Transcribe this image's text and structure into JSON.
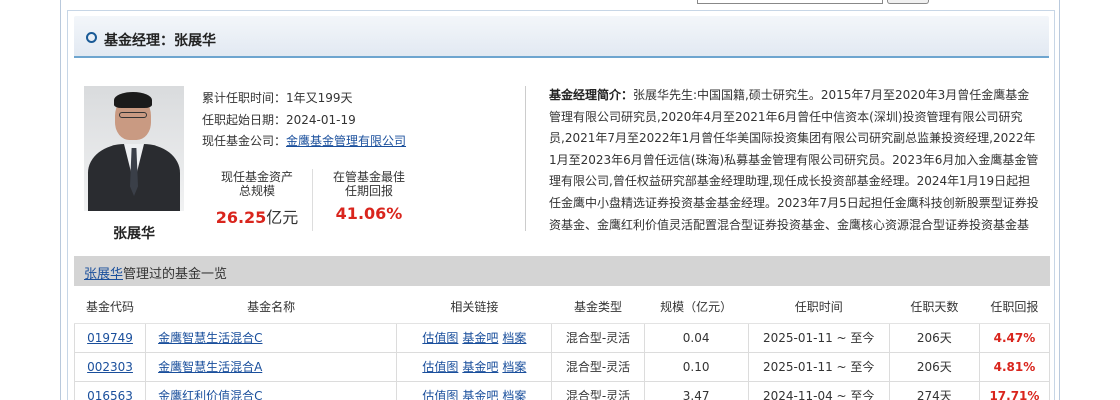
{
  "section_title": "基金经理：张展华",
  "manager": {
    "name": "张展华",
    "tenure_label": "累计任职时间：",
    "tenure_value": "1年又199天",
    "start_label": "任职起始日期：",
    "start_value": "2024-01-19",
    "company_label": "现任基金公司：",
    "company_value": "金鹰基金管理有限公司",
    "aum_label_line1": "现任基金资产",
    "aum_label_line2": "总规模",
    "aum_value": "26.25",
    "aum_unit": "亿元",
    "best_label_line1": "在管基金最佳",
    "best_label_line2": "任期回报",
    "best_value": "41.06%"
  },
  "bio": {
    "label": "基金经理简介：",
    "text": "张展华先生:中国国籍,硕士研究生。2015年7月至2020年3月曾任金鹰基金管理有限公司研究员,2020年4月至2021年6月曾任中信资本(深圳)投资管理有限公司研究员,2021年7月至2022年1月曾任华美国际投资集团有限公司研究副总监兼投资经理,2022年1月至2023年6月曾任远信(珠海)私募基金管理有限公司研究员。2023年6月加入金鹰基金管理有限公司,曾任权益研究部基金经理助理,现任成长投资部基金经理。2024年1月19日起担任金鹰中小盘精选证券投资基金基金经理。2023年7月5日起担任金鹰科技创新股票型证券投资基金、金鹰红利价值灵活配置混合型证券投资基金、金鹰核心资源混合型证券投资基金基金经"
  },
  "list_header": {
    "name_link": "张展华",
    "suffix": "管理过的基金一览"
  },
  "table": {
    "headers": [
      "基金代码",
      "基金名称",
      "相关链接",
      "基金类型",
      "规模（亿元）",
      "任职时间",
      "任职天数",
      "任职回报"
    ],
    "link_labels": [
      "估值图",
      "基金吧",
      "档案"
    ],
    "rows": [
      {
        "code": "019749",
        "name": "金鹰智慧生活混合C",
        "type": "混合型-灵活",
        "size": "0.04",
        "period": "2025-01-11 ~ 至今",
        "days": "206天",
        "ret": "4.47%"
      },
      {
        "code": "002303",
        "name": "金鹰智慧生活混合A",
        "type": "混合型-灵活",
        "size": "0.10",
        "period": "2025-01-11 ~ 至今",
        "days": "206天",
        "ret": "4.81%"
      },
      {
        "code": "016563",
        "name": "金鹰红利价值混合C",
        "type": "混合型-灵活",
        "size": "3.47",
        "period": "2024-11-04 ~ 至今",
        "days": "274天",
        "ret": "17.71%"
      }
    ]
  },
  "colors": {
    "accent_blue": "#1a4f9c",
    "return_red": "#d9251d",
    "title_underline": "#6ea5cf"
  }
}
